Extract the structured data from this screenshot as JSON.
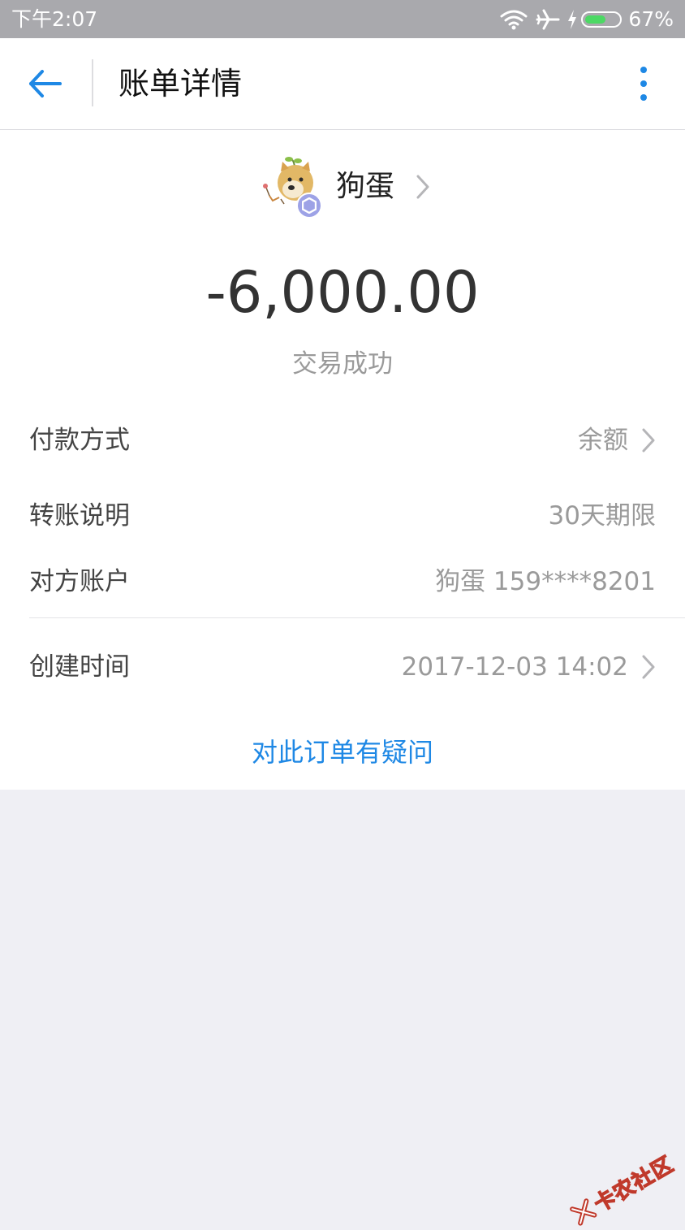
{
  "status_bar": {
    "time": "下午2:07",
    "battery_percent_text": "67%",
    "battery_level": 0.67,
    "icons": [
      "wifi-icon",
      "airplane-icon",
      "charging-icon",
      "battery-icon"
    ]
  },
  "app_bar": {
    "title": "账单详情",
    "back_icon": "arrow-left-icon",
    "more_icon": "more-vertical-icon"
  },
  "payee": {
    "name": "狗蛋",
    "avatar_icon": "doge-avatar",
    "badge_icon": "hexagon-badge-icon"
  },
  "amount": "-6,000.00",
  "transaction_status": "交易成功",
  "rows": [
    {
      "label": "付款方式",
      "value": "余额",
      "has_chevron": true
    },
    {
      "label": "转账说明",
      "value": "30天期限",
      "has_chevron": false
    },
    {
      "label": "对方账户",
      "value": "狗蛋 159****8201",
      "has_chevron": false
    },
    {
      "label": "创建时间",
      "value": "2017-12-03 14:02",
      "has_chevron": true
    }
  ],
  "question_link": "对此订单有疑问",
  "watermark": "卡农社区",
  "colors": {
    "accent": "#1e88e5",
    "status_bar": "#a9a9ad",
    "page_background": "#efeff4",
    "battery": "#4cd964"
  }
}
